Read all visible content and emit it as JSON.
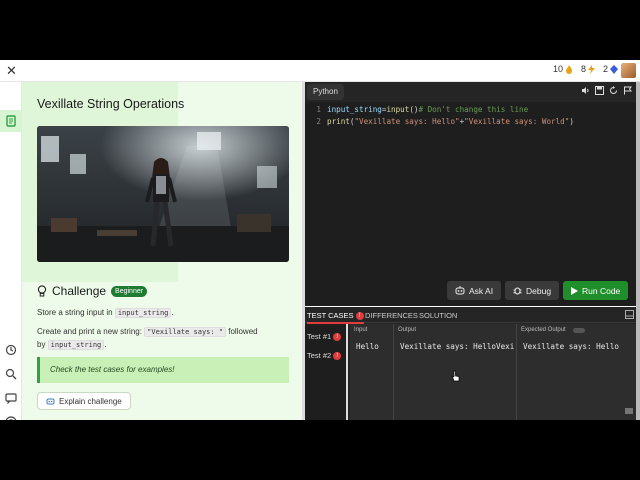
{
  "topbar": {
    "close_label": "✕",
    "stats": [
      {
        "value": "10",
        "icon": "fire-icon",
        "color": "#e8a317"
      },
      {
        "value": "8",
        "icon": "bolt-icon",
        "color": "#e8a317"
      },
      {
        "value": "2",
        "icon": "gem-icon",
        "color": "#3b5bdb"
      }
    ]
  },
  "problem": {
    "title": "Vexillate String Operations",
    "challenge_title": "Challenge",
    "difficulty": "Beginner",
    "line1_pre": "Store a string input in ",
    "line1_code": "input_string",
    "line1_post": ".",
    "line2_pre": "Create and print a new string: ",
    "line2_code": "\"Vexillate says: \"",
    "line2_mid": " followed",
    "line3_pre": "by ",
    "line3_code": "input_string",
    "line3_post": ".",
    "tip": "Check the test cases for examples!",
    "explain_label": "Explain challenge"
  },
  "editor": {
    "language_tab": "Python",
    "lines": [
      {
        "num": "1",
        "a": "input_string",
        "b": " = ",
        "c": "input",
        "d": "()",
        "e": " # Don't change this line"
      },
      {
        "num": "2",
        "a": "print",
        "b": "(",
        "c": "\"Vexillate says: Hello\"",
        "d": " + ",
        "e": "\"Vexillate says: World\"",
        "f": ")"
      }
    ]
  },
  "actions": {
    "ask_ai": "Ask AI",
    "debug": "Debug",
    "run": "Run Code"
  },
  "results": {
    "tabs": {
      "test_cases": "TEST CASES",
      "test_cases_badge": "!",
      "differences": "DIFFERENCES",
      "solution": "SOLUTION"
    },
    "tests": [
      {
        "label": "Test #1",
        "badge": "!"
      },
      {
        "label": "Test #2",
        "badge": "!"
      }
    ],
    "columns": {
      "input_header": "Input",
      "output_header": "Output",
      "expected_header": "Expected Output",
      "input_value": "Hello",
      "output_value": "Vexillate says: HelloVexi",
      "expected_value": "Vexillate says: Hello"
    }
  },
  "colors": {
    "accent_green": "#1f8f2b",
    "error_red": "#e03c3c",
    "panel_bg": "#eefbea"
  }
}
